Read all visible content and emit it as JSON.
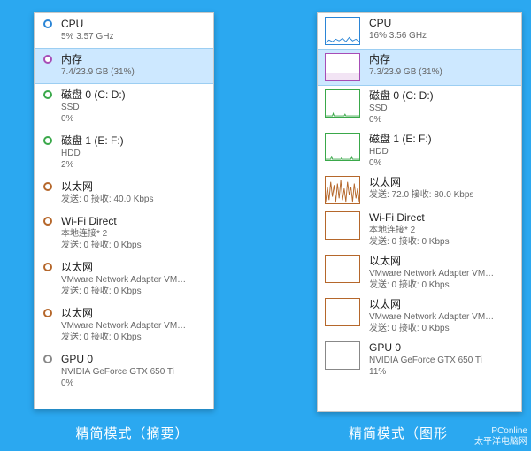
{
  "captions": {
    "left": "精简模式（摘要）",
    "right": "精简模式（图形"
  },
  "watermark": {
    "line1": "PConline",
    "line2": "太平洋电脑网"
  },
  "left": {
    "items": [
      {
        "title": "CPU",
        "sub": "5%  3.57 GHz",
        "color": "#2b85d6",
        "subcolor": "#555"
      },
      {
        "title": "内存",
        "sub": "7.4/23.9 GB (31%)",
        "color": "#a74db6",
        "subcolor": "#555",
        "selected": true
      },
      {
        "title": "磁盘 0 (C: D:)",
        "sub1": "SSD",
        "sub2": "0%",
        "color": "#3aa84a"
      },
      {
        "title": "磁盘 1 (E: F:)",
        "sub1": "HDD",
        "sub2": "2%",
        "color": "#3aa84a"
      },
      {
        "title": "以太网",
        "sub": "发送: 0 接收: 40.0 Kbps",
        "color": "#b5672b"
      },
      {
        "title": "Wi-Fi Direct",
        "sub1": "本地连接* 2",
        "sub2": "发送: 0 接收: 0 Kbps",
        "color": "#b5672b"
      },
      {
        "title": "以太网",
        "sub1": "VMware Network Adapter VM…",
        "sub2": "发送: 0 接收: 0 Kbps",
        "color": "#b5672b"
      },
      {
        "title": "以太网",
        "sub1": "VMware Network Adapter VM…",
        "sub2": "发送: 0 接收: 0 Kbps",
        "color": "#b5672b"
      },
      {
        "title": "GPU 0",
        "sub1": "NVIDIA GeForce GTX 650 Ti",
        "sub2": "0%",
        "color": "#888"
      }
    ]
  },
  "right": {
    "items": [
      {
        "title": "CPU",
        "sub": "16%  3.56 GHz",
        "color": "#2b85d6",
        "graph": "cpu"
      },
      {
        "title": "内存",
        "sub": "7.3/23.9 GB (31%)",
        "color": "#a74db6",
        "graph": "mem",
        "selected": true
      },
      {
        "title": "磁盘 0 (C: D:)",
        "sub1": "SSD",
        "sub2": "0%",
        "color": "#3aa84a",
        "graph": "disklow"
      },
      {
        "title": "磁盘 1 (E: F:)",
        "sub1": "HDD",
        "sub2": "0%",
        "color": "#3aa84a",
        "graph": "disklow"
      },
      {
        "title": "以太网",
        "sub": "发送: 72.0 接收: 80.0 Kbps",
        "color": "#b5672b",
        "graph": "netbusy"
      },
      {
        "title": "Wi-Fi Direct",
        "sub1": "本地连接* 2",
        "sub2": "发送: 0 接收: 0 Kbps",
        "color": "#b5672b",
        "graph": "flat"
      },
      {
        "title": "以太网",
        "sub1": "VMware Network Adapter VM…",
        "sub2": "发送: 0 接收: 0 Kbps",
        "color": "#b5672b",
        "graph": "flat"
      },
      {
        "title": "以太网",
        "sub1": "VMware Network Adapter VM…",
        "sub2": "发送: 0 接收: 0 Kbps",
        "color": "#b5672b",
        "graph": "flat"
      },
      {
        "title": "GPU 0",
        "sub1": "NVIDIA GeForce GTX 650 Ti",
        "sub2": "11%",
        "color": "#888",
        "graph": "flat"
      }
    ]
  }
}
